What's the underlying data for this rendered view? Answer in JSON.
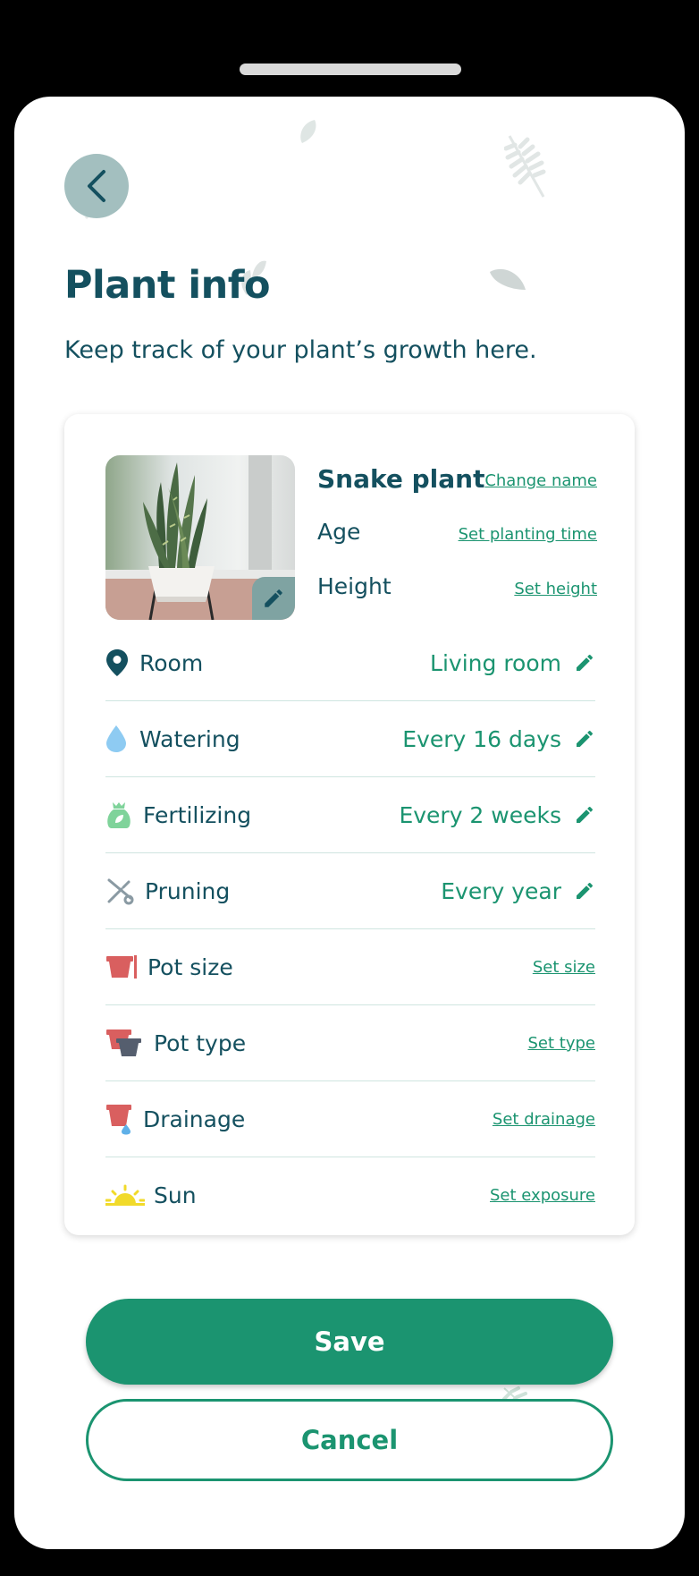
{
  "header": {
    "title": "Plant info",
    "subtitle": "Keep track of your plant’s growth here."
  },
  "plant": {
    "name": "Snake plant",
    "change_name_label": "Change name",
    "age_label": "Age",
    "age_action": "Set planting time",
    "height_label": "Height",
    "height_action": "Set height"
  },
  "rows": [
    {
      "label": "Room",
      "value": "Living room",
      "icon": "location-pin-icon"
    },
    {
      "label": "Watering",
      "value": "Every 16 days",
      "icon": "water-drop-icon"
    },
    {
      "label": "Fertilizing",
      "value": "Every 2 weeks",
      "icon": "fertilizer-bag-icon"
    },
    {
      "label": "Pruning",
      "value": "Every year",
      "icon": "scissors-icon"
    },
    {
      "label": "Pot size",
      "action": "Set size",
      "icon": "pot-size-icon"
    },
    {
      "label": "Pot type",
      "action": "Set type",
      "icon": "pot-type-icon"
    },
    {
      "label": "Drainage",
      "action": "Set drainage",
      "icon": "drainage-pot-icon"
    },
    {
      "label": "Sun",
      "action": "Set exposure",
      "icon": "sun-icon"
    }
  ],
  "actions": {
    "save_label": "Save",
    "cancel_label": "Cancel"
  },
  "colors": {
    "primary": "#1b9470",
    "heading": "#14505f",
    "back_button": "#a3bfbf"
  }
}
